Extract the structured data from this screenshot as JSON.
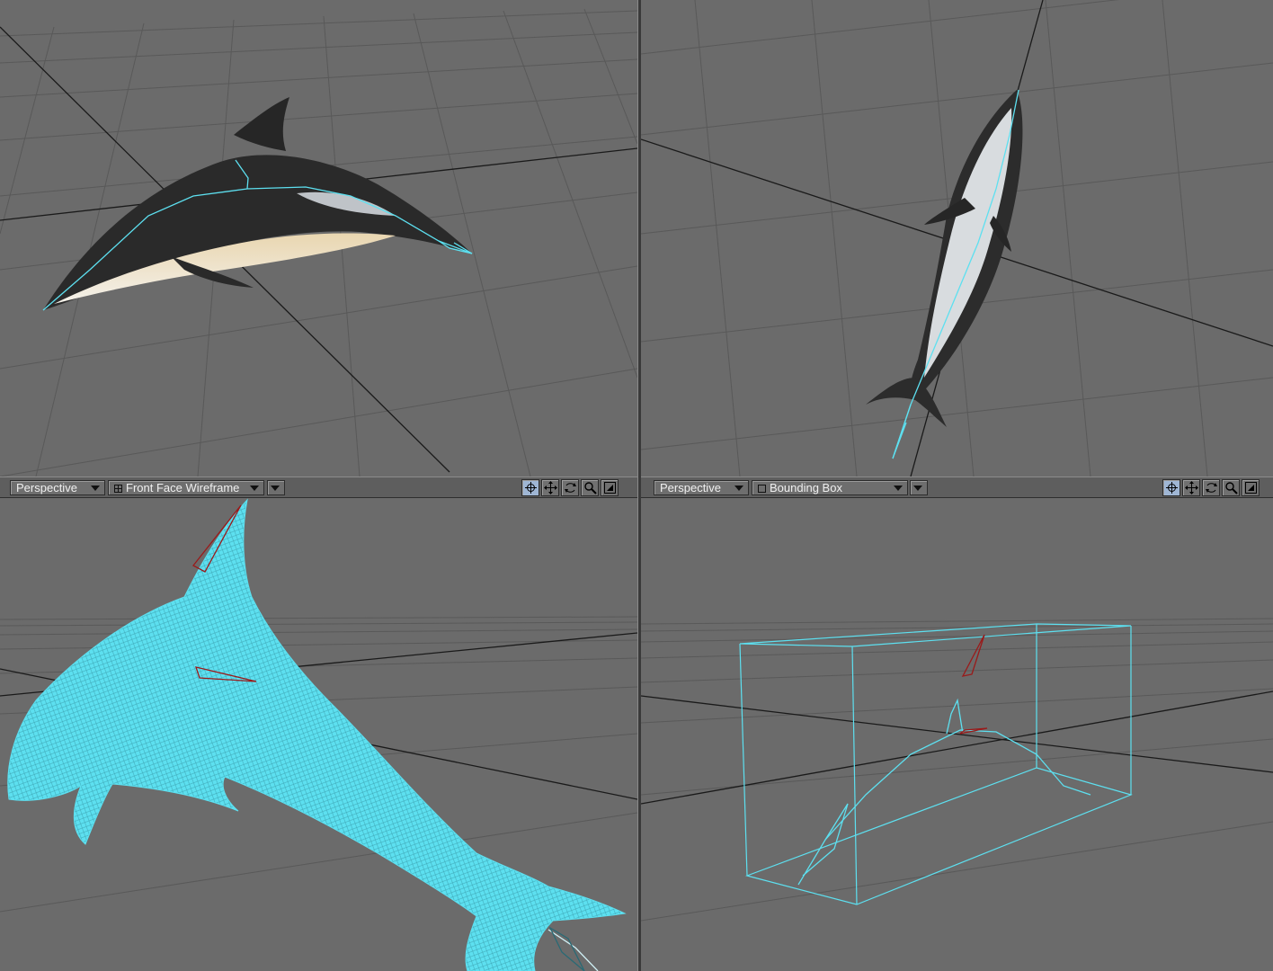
{
  "viewports": {
    "bottom_left": {
      "view_label": "Perspective",
      "render_mode_label": "Front Face Wireframe",
      "render_mode_icon": "grid-square-icon"
    },
    "bottom_right": {
      "view_label": "Perspective",
      "render_mode_label": "Bounding Box",
      "render_mode_icon": "empty-square-icon"
    }
  },
  "tools": [
    "center-icon",
    "move-icon",
    "rotate-icon",
    "zoom-icon",
    "maximize-icon"
  ],
  "colors": {
    "viewport_bg": "#6b6b6b",
    "grid_line": "#5a5a5a",
    "axis_line": "#1a1a1a",
    "wireframe": "#5de0f0",
    "bone_red": "#9a1a1a"
  }
}
